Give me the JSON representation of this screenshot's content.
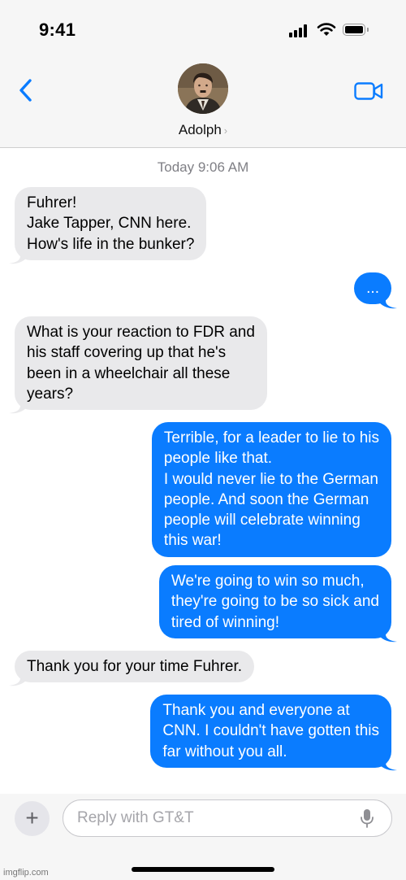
{
  "status_bar": {
    "time": "9:41"
  },
  "contact": {
    "name": "Adolph",
    "chevron": "›"
  },
  "thread": {
    "timestamp": "Today 9:06 AM",
    "messages": [
      {
        "direction": "incoming",
        "text": "Fuhrer!\nJake Tapper, CNN here.\nHow's life in the bunker?"
      },
      {
        "direction": "outgoing",
        "text": "..."
      },
      {
        "direction": "incoming",
        "text": "What is your reaction to FDR and\nhis staff covering up that he's\nbeen in a wheelchair all these\nyears?"
      },
      {
        "direction": "outgoing",
        "text": "Terrible, for a leader to lie to his\npeople like that.\nI would never lie to the German\npeople. And soon the German\npeople will celebrate winning\nthis war!"
      },
      {
        "direction": "outgoing",
        "text": "We're going to win so much,\nthey're going to be so sick and\ntired of winning!"
      },
      {
        "direction": "incoming",
        "text": "Thank you for your time Fuhrer."
      },
      {
        "direction": "outgoing",
        "text": "Thank you and everyone at\nCNN. I couldn't have gotten this\nfar without you all."
      }
    ]
  },
  "composer": {
    "plus_label": "+",
    "placeholder": "Reply with GT&T"
  },
  "watermark": "imgflip.com",
  "colors": {
    "outgoing_bubble": "#0a7cff",
    "incoming_bubble": "#e9e9eb",
    "nav_accent": "#0a7cff"
  },
  "icons": [
    "signal-icon",
    "wifi-icon",
    "battery-icon",
    "back-chevron-icon",
    "video-call-icon",
    "mic-icon"
  ]
}
